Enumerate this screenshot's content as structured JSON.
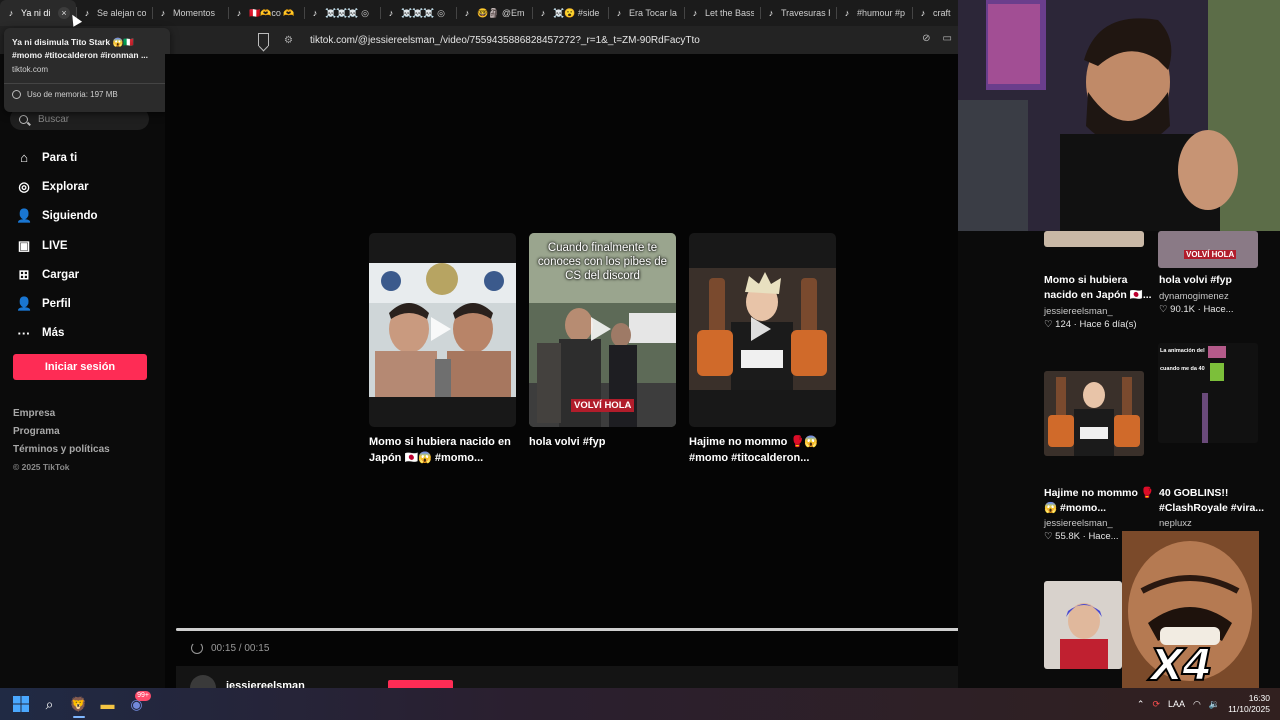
{
  "browser": {
    "tabs": [
      {
        "label": "Ya ni di",
        "icon": "tiktok-icon",
        "active": true
      },
      {
        "label": "Se alejan co",
        "icon": "tiktok-icon"
      },
      {
        "label": "Momentos",
        "icon": "tiktok-icon"
      },
      {
        "label": "🇵🇪🫶co 🫶",
        "icon": "tiktok-icon"
      },
      {
        "label": "☠️☠️☠️ ◎",
        "icon": "tiktok-icon"
      },
      {
        "label": "☠️☠️☠️ ◎",
        "icon": "tiktok-icon"
      },
      {
        "label": "🤓🗿 @Em",
        "icon": "tiktok-icon"
      },
      {
        "label": "☠️😮 #side",
        "icon": "tiktok-icon"
      },
      {
        "label": "Era Tocar la",
        "icon": "tiktok-icon"
      },
      {
        "label": "Let the Bass",
        "icon": "tiktok-icon"
      },
      {
        "label": "Travesuras R",
        "icon": "tiktok-icon"
      },
      {
        "label": "#humour #p",
        "icon": "tiktok-icon"
      },
      {
        "label": "craft",
        "icon": "tiktok-icon"
      }
    ],
    "url": "tiktok.com/@jessiereelsman_/video/7559435886828457272?_r=1&_t=ZM-90RdFacyTto",
    "hover_card": {
      "title": "Ya ni disimula Tito Stark 😱🇮🇹 #momo #titocalderon #ironman ...",
      "domain": "tiktok.com",
      "memory": "Uso de memoria: 197 MB"
    }
  },
  "sidebar": {
    "search_placeholder": "Buscar",
    "nav": [
      {
        "label": "Para ti",
        "icon": "home-icon",
        "glyph": "⌂"
      },
      {
        "label": "Explorar",
        "icon": "compass-icon",
        "glyph": "◎"
      },
      {
        "label": "Siguiendo",
        "icon": "following-icon",
        "glyph": "👤"
      },
      {
        "label": "LIVE",
        "icon": "live-icon",
        "glyph": "▣"
      },
      {
        "label": "Cargar",
        "icon": "upload-icon",
        "glyph": "⊞"
      },
      {
        "label": "Perfil",
        "icon": "profile-icon",
        "glyph": "👤"
      },
      {
        "label": "Más",
        "icon": "more-icon",
        "glyph": "···"
      }
    ],
    "login_label": "Iniciar sesión",
    "footer": [
      "Empresa",
      "Programa",
      "Términos y políticas"
    ],
    "copyright": "© 2025 TikTok"
  },
  "main": {
    "cards": [
      {
        "title": "Momo si hubiera nacido en Japón 🇯🇵😱 #momo...",
        "overlay": "",
        "badge": ""
      },
      {
        "title": "hola volvi #fyp",
        "overlay": "Cuando finalmente te conoces con los pibes de CS del discord",
        "badge": "VOLVÍ HOLA"
      },
      {
        "title": "Hajime no mommo 🥊😱 #momo #titocalderon...",
        "overlay": "",
        "badge": ""
      }
    ],
    "progress": 1.0,
    "time": "00:15 / 00:15",
    "author": "jessiereelsman_"
  },
  "right_column": {
    "videos": [
      {
        "title": "Momo si hubiera nacido en Japón 🇯🇵...",
        "author": "jessiereelsman_",
        "likes": "♡ 124",
        "when": "Hace 6 día(s)"
      },
      {
        "title": "hola volvi #fyp",
        "author": "dynamogimenez",
        "likes": "♡ 90.1K",
        "when": "Hace..."
      },
      {
        "title": "Hajime no mommo 🥊😱 #momo...",
        "author": "jessiereelsman_",
        "likes": "♡ 55.8K",
        "when": "Hace..."
      },
      {
        "title": "40 GOBLINS!! #ClashRoyale #vira...",
        "author": "nepluxz",
        "likes": "",
        "when": ""
      }
    ],
    "thumb_captions": [
      "VOLVÍ HOLA",
      "La animación del",
      "cuando me da 40"
    ]
  },
  "meme": {
    "multiplier": "X4"
  },
  "taskbar": {
    "badge_count": "99+",
    "language": "LAA",
    "time": "16:30",
    "date": "11/10/2025"
  }
}
